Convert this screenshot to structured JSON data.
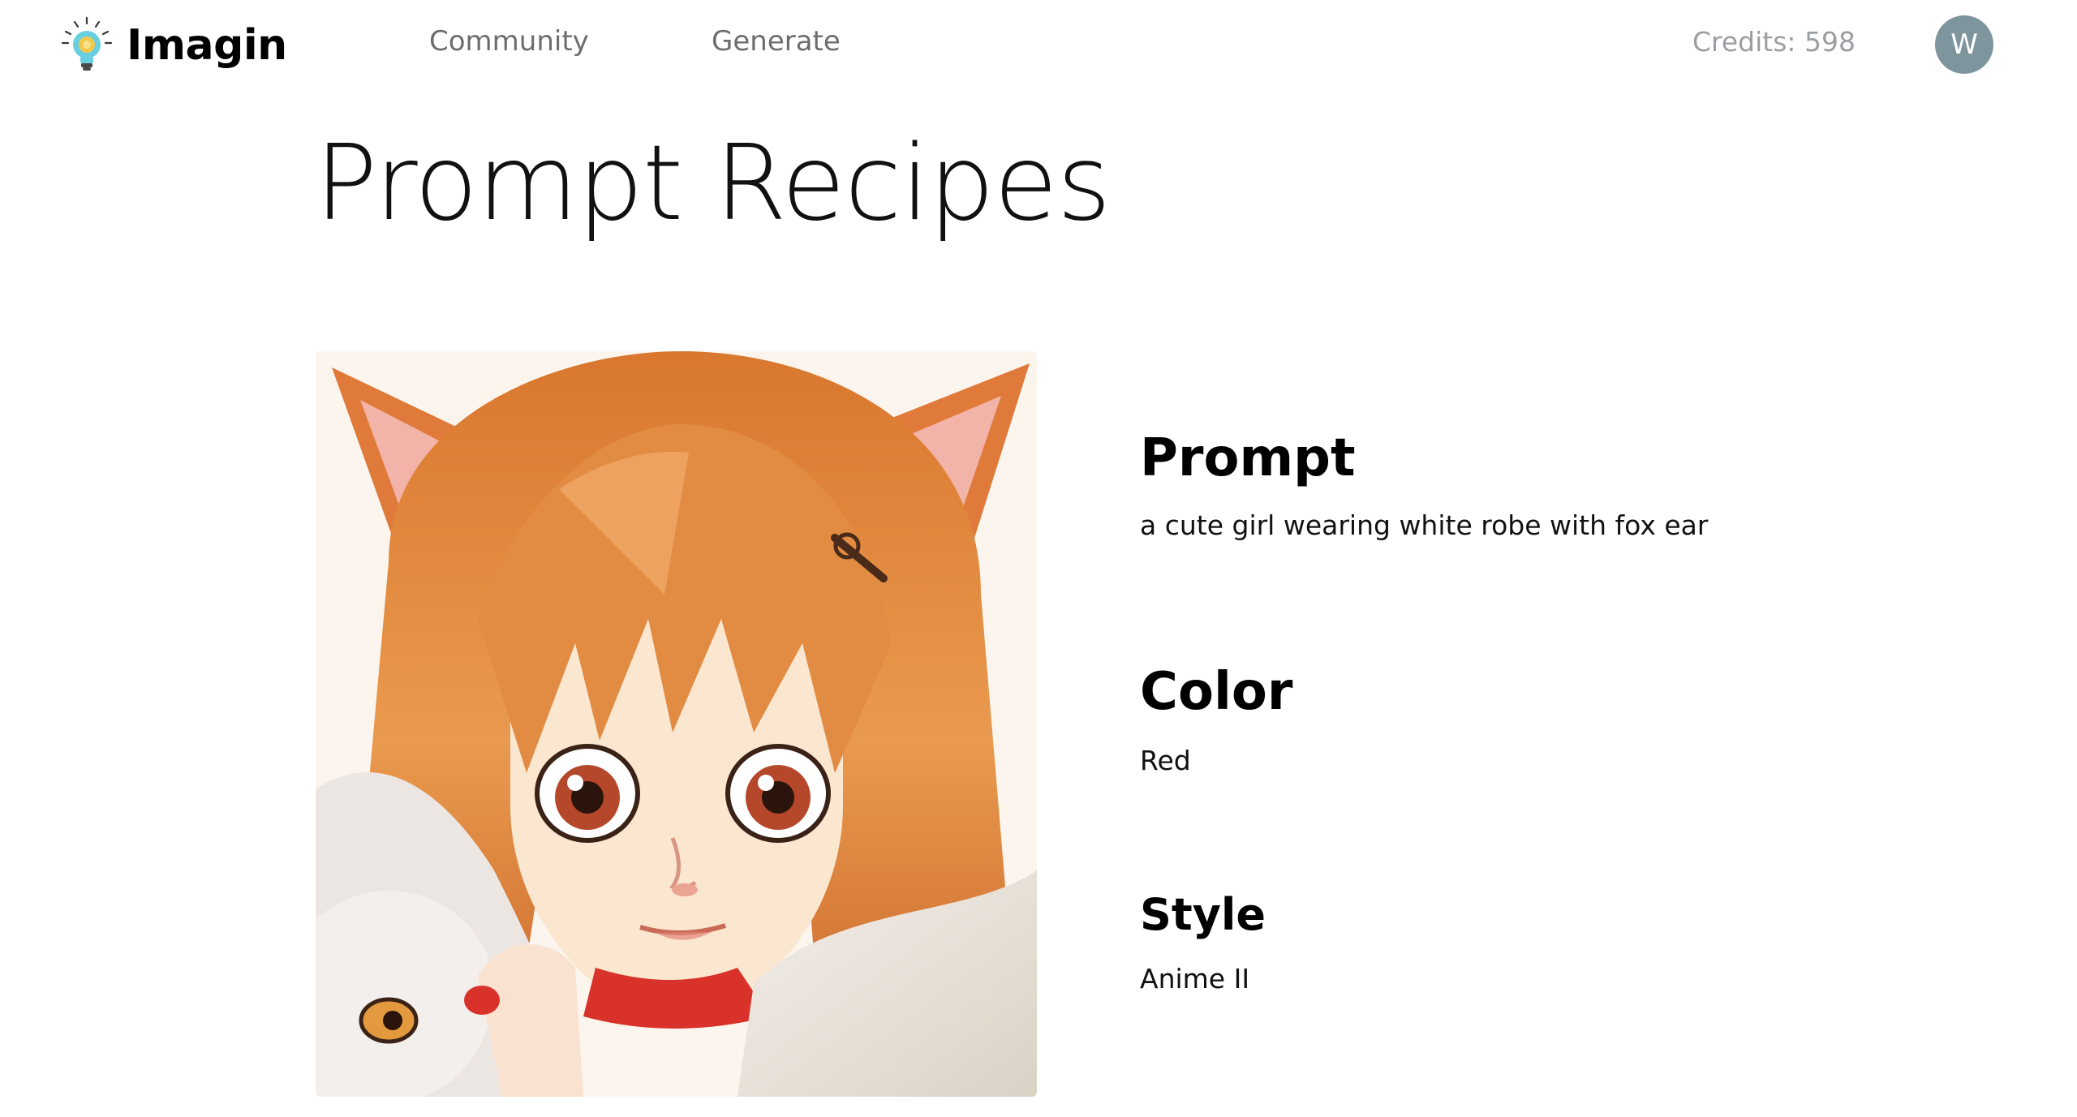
{
  "header": {
    "brand_name": "Imagin",
    "brand_icon": "lightbulb-icon",
    "nav": {
      "community_label": "Community",
      "generate_label": "Generate"
    },
    "credits_text": "Credits: 598",
    "avatar_initial": "W"
  },
  "page": {
    "title": "Prompt Recipes"
  },
  "recipe": {
    "image_subject": "anime-girl-illustration",
    "prompt_heading": "Prompt",
    "prompt_value": "a cute girl wearing white robe with fox ear",
    "color_heading": "Color",
    "color_value": "Red",
    "style_heading": "Style",
    "style_value": "Anime II"
  },
  "colors": {
    "avatar_bg": "#7e959e",
    "nav_text": "#6d6d6d",
    "credits_text": "#9a9ea3",
    "hair": "#e08a3c",
    "accent_red": "#d8322a"
  }
}
